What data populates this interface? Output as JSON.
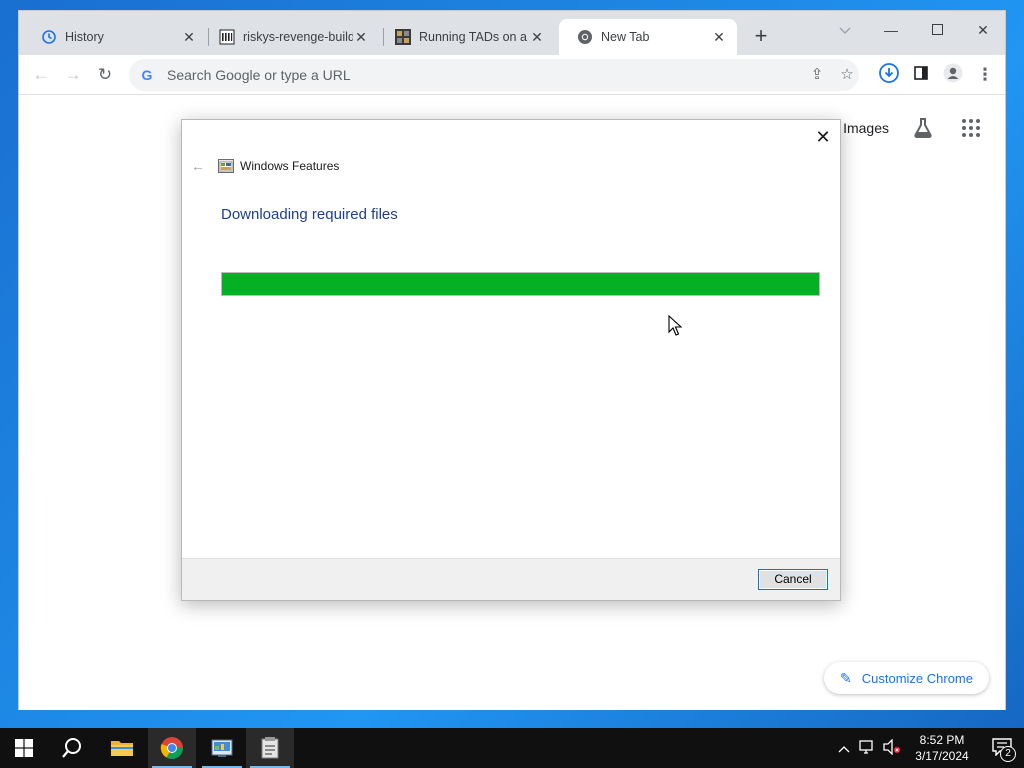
{
  "browser": {
    "tabs": [
      {
        "title": "History",
        "icon": "history-icon",
        "active": false
      },
      {
        "title": "riskys-revenge-builds",
        "icon": "bank-icon",
        "active": false
      },
      {
        "title": "Running TADs on a re",
        "icon": "tads-icon",
        "active": false
      },
      {
        "title": "New Tab",
        "icon": "chrome-icon",
        "active": true
      }
    ],
    "omnibox": {
      "placeholder": "Search Google or type a URL"
    },
    "page": {
      "images_label": "Images",
      "customize_label": "Customize Chrome"
    }
  },
  "dialog": {
    "title": "Windows Features",
    "heading": "Downloading required files",
    "progress": 1.0,
    "progress_color": "#06b025",
    "cancel_label": "Cancel"
  },
  "taskbar": {
    "apps": [
      "start-icon",
      "search-icon",
      "file-explorer-icon",
      "chrome-icon",
      "control-panel-icon",
      "installer-icon"
    ],
    "clock_time": "8:52 PM",
    "clock_date": "3/17/2024",
    "notification_count": "2"
  }
}
